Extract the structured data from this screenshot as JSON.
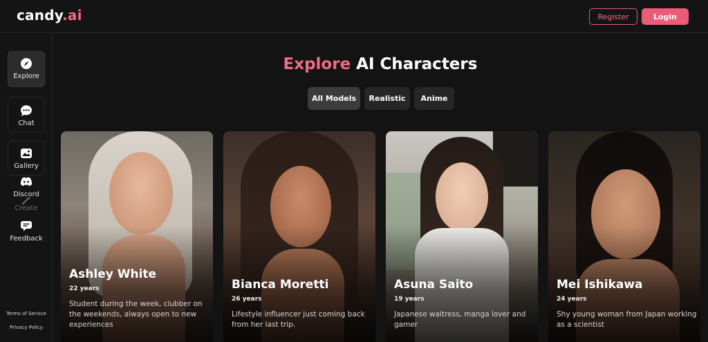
{
  "header": {
    "logo_main": "candy",
    "logo_accent": ".ai",
    "register_label": "Register",
    "login_label": "Login"
  },
  "sidebar": {
    "items": [
      {
        "label": "Explore",
        "icon": "compass-icon"
      },
      {
        "label": "Chat",
        "icon": "chat-bubble-icon"
      },
      {
        "label": "Gallery",
        "icon": "image-icon"
      },
      {
        "label": "Discord",
        "icon": "discord-icon"
      },
      {
        "label": "Create",
        "icon": "wand-icon"
      },
      {
        "label": "Feedback",
        "icon": "feedback-icon"
      }
    ],
    "terms_label": "Terms of Service",
    "privacy_label": "Privacy Policy"
  },
  "main": {
    "title_accent": "Explore",
    "title_rest": " AI Characters",
    "filters": [
      {
        "label": "All Models",
        "active": true
      },
      {
        "label": "Realistic",
        "active": false
      },
      {
        "label": "Anime",
        "active": false
      }
    ]
  },
  "characters": [
    {
      "name": "Ashley White",
      "age": "22 years",
      "description": "Student during the week, clubber on the weekends, always open to new experiences"
    },
    {
      "name": "Bianca Moretti",
      "age": "26 years",
      "description": "Lifestyle influencer just coming back from her last trip."
    },
    {
      "name": "Asuna Saito",
      "age": "19 years",
      "description": "Japanese waitress, manga lover and gamer"
    },
    {
      "name": "Mei Ishikawa",
      "age": "24 years",
      "description": "Shy young woman from Japan working as a scientist"
    }
  ],
  "colors": {
    "accent": "#f06b84",
    "login_bg": "#ea5c78",
    "background": "#131313",
    "chip_bg": "#262626",
    "chip_active_bg": "#3c3c3c"
  }
}
